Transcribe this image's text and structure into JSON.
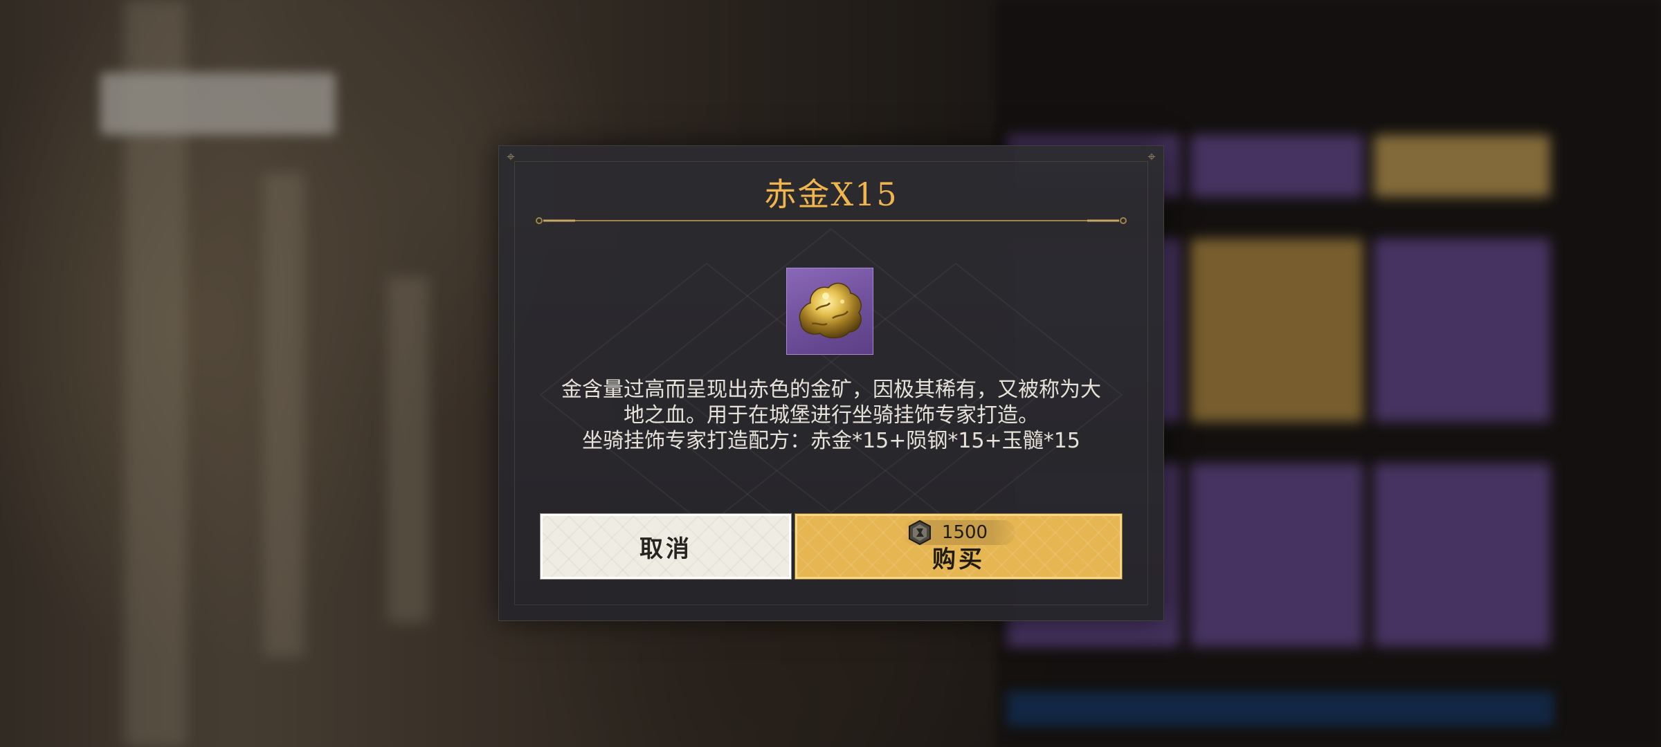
{
  "dialog": {
    "title": "赤金X15",
    "item": {
      "icon": "gold-nugget-icon",
      "rarity_color": "#7a5aa8"
    },
    "description": [
      "金含量过高而呈现出赤色的金矿，因极其稀有，又被称为大",
      "地之血。用于在城堡进行坐骑挂饰专家打造。",
      "坐骑挂饰专家打造配方：赤金*15+陨钢*15+玉髓*15"
    ],
    "cancel_button": {
      "label": "取消"
    },
    "buy_button": {
      "label": "购买",
      "price": "1500",
      "currency_icon": "currency-stone-icon"
    }
  },
  "colors": {
    "title": "#f0b54d",
    "buy_button": "#e6b653",
    "cancel_button": "#efece4",
    "dialog_bg": "#2c2b30"
  }
}
